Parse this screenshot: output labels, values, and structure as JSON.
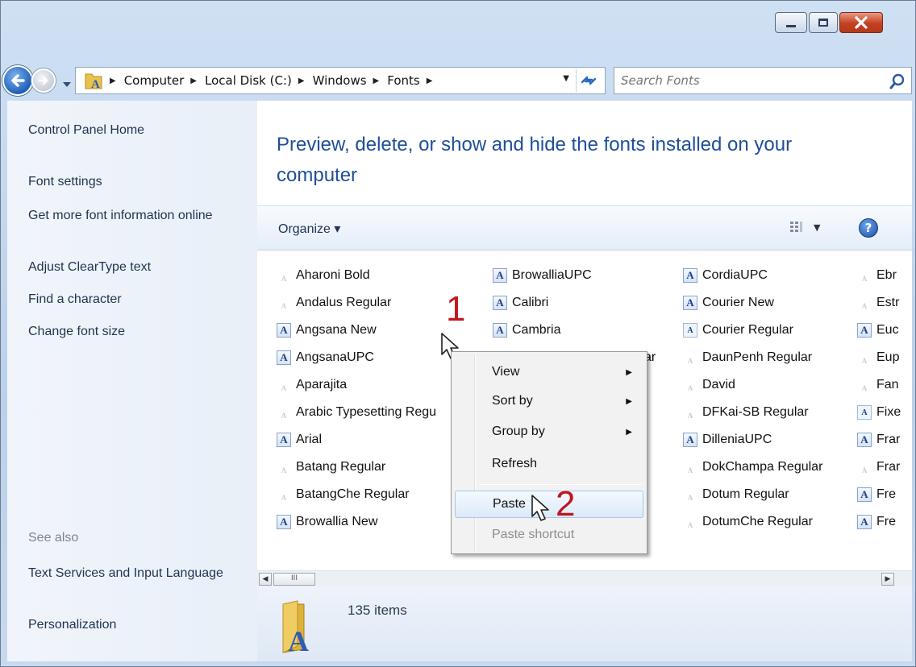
{
  "window": {
    "caption_buttons": {
      "minimize": "minimize-icon",
      "maximize": "maximize-icon",
      "close": "close-icon"
    }
  },
  "address": {
    "crumbs": [
      "Computer",
      "Local Disk (C:)",
      "Windows",
      "Fonts"
    ]
  },
  "search": {
    "placeholder": "Search Fonts"
  },
  "left_pane": {
    "links": [
      "Control Panel Home",
      "Font settings",
      "Get more font information online",
      "Adjust ClearType text",
      "Find a character",
      "Change font size"
    ],
    "see_also_label": "See also",
    "see_also_links": [
      "Text Services and Input Language",
      "Personalization"
    ]
  },
  "main": {
    "heading": "Preview, delete, or show and hide the fonts installed on your computer",
    "toolbar": {
      "organize_label": "Organize ▾"
    }
  },
  "fonts": {
    "col1": [
      {
        "name": "Aharoni Bold",
        "icon": "faint"
      },
      {
        "name": "Andalus Regular",
        "icon": "faint"
      },
      {
        "name": "Angsana New",
        "icon": "full"
      },
      {
        "name": "AngsanaUPC",
        "icon": "full"
      },
      {
        "name": "Aparajita",
        "icon": "faint"
      },
      {
        "name": "Arabic Typesetting Regu",
        "icon": "faint"
      },
      {
        "name": "Arial",
        "icon": "full"
      },
      {
        "name": "Batang Regular",
        "icon": "faint"
      },
      {
        "name": "BatangChe Regular",
        "icon": "faint"
      },
      {
        "name": "Browallia New",
        "icon": "full"
      }
    ],
    "col2": [
      {
        "name": "BrowalliaUPC",
        "icon": "full"
      },
      {
        "name": "Calibri",
        "icon": "full"
      },
      {
        "name": "Cambria",
        "icon": "full"
      }
    ],
    "col2_partial": "ar",
    "col3": [
      {
        "name": "CordiaUPC",
        "icon": "full"
      },
      {
        "name": "Courier New",
        "icon": "full"
      },
      {
        "name": "Courier Regular",
        "icon": "small"
      },
      {
        "name": "DaunPenh Regular",
        "icon": "faint"
      },
      {
        "name": "David",
        "icon": "faint"
      },
      {
        "name": "DFKai-SB Regular",
        "icon": "faint"
      },
      {
        "name": "DilleniaUPC",
        "icon": "full"
      },
      {
        "name": "DokChampa Regular",
        "icon": "faint"
      },
      {
        "name": "Dotum Regular",
        "icon": "faint"
      },
      {
        "name": "DotumChe Regular",
        "icon": "faint"
      }
    ],
    "col4": [
      {
        "name": "Ebr",
        "icon": "faint"
      },
      {
        "name": "Estr",
        "icon": "faint"
      },
      {
        "name": "Euc",
        "icon": "full"
      },
      {
        "name": "Eup",
        "icon": "faint"
      },
      {
        "name": "Fan",
        "icon": "faint"
      },
      {
        "name": "Fixe",
        "icon": "small"
      },
      {
        "name": "Frar",
        "icon": "full"
      },
      {
        "name": "Frar",
        "icon": "faint"
      },
      {
        "name": "Fre",
        "icon": "full"
      },
      {
        "name": "Fre",
        "icon": "full"
      }
    ]
  },
  "scrollbar": {
    "thumb_grip": "III"
  },
  "details": {
    "item_count": "135 items"
  },
  "context_menu": {
    "items": [
      {
        "label": "View",
        "submenu": true
      },
      {
        "label": "Sort by",
        "submenu": true
      },
      {
        "label": "Group by",
        "submenu": true
      },
      {
        "label": "Refresh",
        "submenu": false
      },
      {
        "label": "Paste",
        "submenu": false,
        "highlighted": true
      },
      {
        "label": "Paste shortcut",
        "submenu": false,
        "disabled": true
      }
    ]
  },
  "annotations": {
    "step1": "1",
    "step2": "2"
  },
  "colors": {
    "heading": "#1f4e9a",
    "annotation": "#c4141c",
    "link": "#1e3350"
  }
}
